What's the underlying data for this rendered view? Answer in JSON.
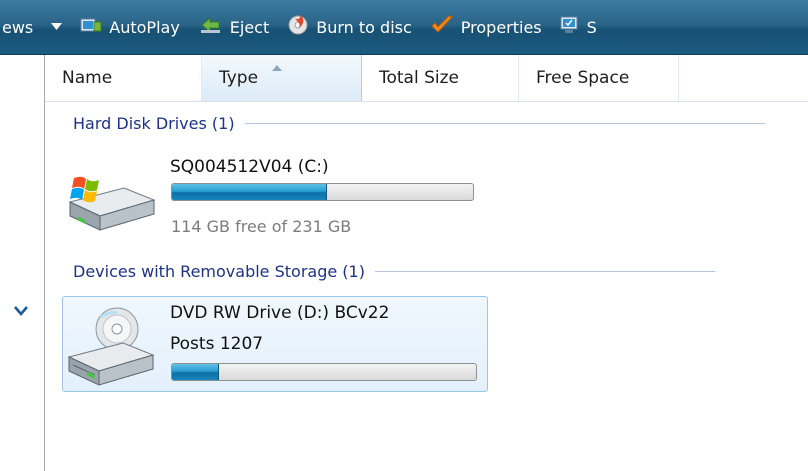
{
  "toolbar": {
    "views_label": "ews",
    "autoplay_label": "AutoPlay",
    "eject_label": "Eject",
    "burn_label": "Burn to disc",
    "properties_label": "Properties",
    "system_label": "S"
  },
  "columns": {
    "name": "Name",
    "type": "Type",
    "total_size": "Total Size",
    "free_space": "Free Space",
    "sorted_by": "Type"
  },
  "groups": {
    "hard_disk": {
      "label": "Hard Disk Drives (1)",
      "drive": {
        "name": "SQ004512V04 (C:)",
        "free_text": "114 GB free of 231 GB",
        "used_fraction": 0.51
      }
    },
    "removable": {
      "label": "Devices with Removable Storage (1)",
      "drive": {
        "name": "DVD RW Drive (D:) BCv22",
        "posts": "Posts 1207",
        "used_fraction": 0.15
      }
    }
  },
  "colors": {
    "toolbar_bg": "#1c5a80",
    "group_header": "#1e3287",
    "bar_fill": "#2a9fd2"
  }
}
